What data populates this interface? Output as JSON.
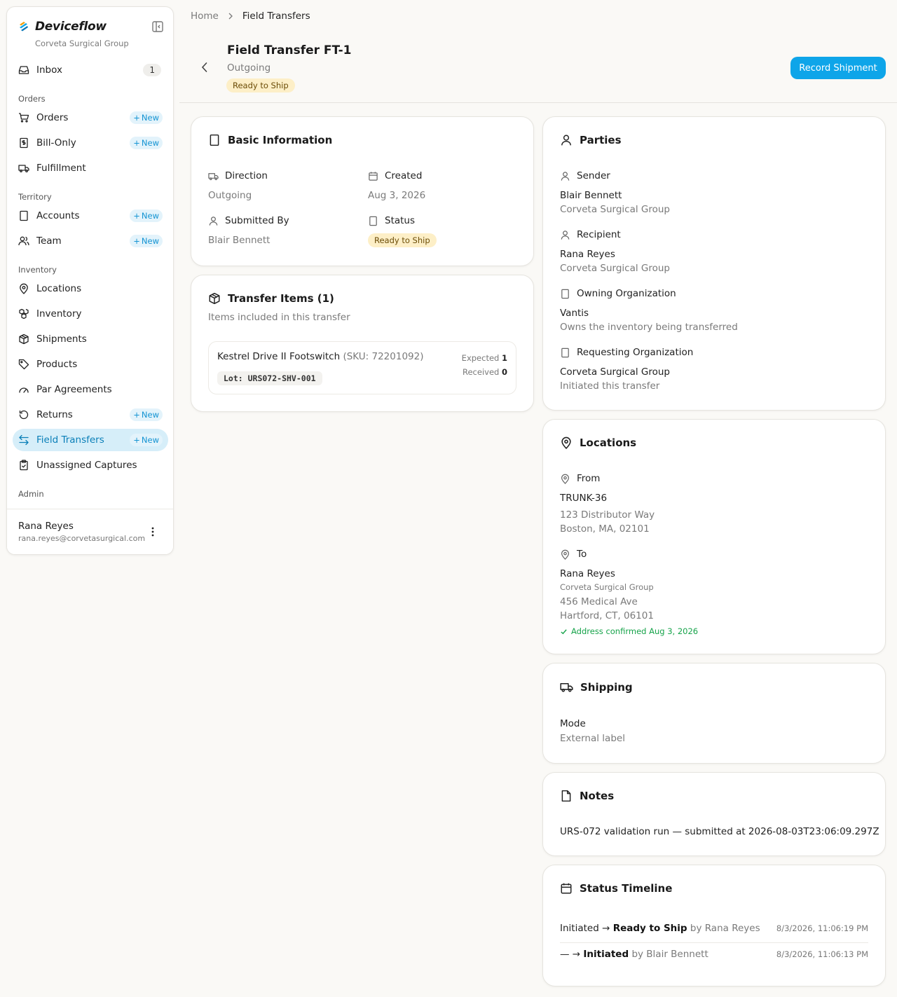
{
  "app": {
    "brand": "Deviceflow",
    "org": "Corveta Surgical Group"
  },
  "sidebar": {
    "inbox": {
      "label": "Inbox",
      "count": "1"
    },
    "sections": {
      "orders": "Orders",
      "territory": "Territory",
      "inventory": "Inventory",
      "admin": "Admin"
    },
    "new_label": "New",
    "items": {
      "orders": "Orders",
      "bill_only": "Bill-Only",
      "fulfillment": "Fulfillment",
      "accounts": "Accounts",
      "team": "Team",
      "locations": "Locations",
      "inventory": "Inventory",
      "shipments": "Shipments",
      "products": "Products",
      "par_agreements": "Par Agreements",
      "returns": "Returns",
      "field_transfers": "Field Transfers",
      "unassigned_captures": "Unassigned Captures"
    },
    "user": {
      "name": "Rana Reyes",
      "email": "rana.reyes@corvetasurgical.com"
    }
  },
  "breadcrumb": {
    "home": "Home",
    "current": "Field Transfers"
  },
  "header": {
    "title": "Field Transfer FT-1",
    "subtitle": "Outgoing",
    "status": "Ready to Ship",
    "primary_action": "Record Shipment"
  },
  "basic_info": {
    "title": "Basic Information",
    "direction_label": "Direction",
    "direction_value": "Outgoing",
    "created_label": "Created",
    "created_value": "Aug 3, 2026",
    "submitted_by_label": "Submitted By",
    "submitted_by_value": "Blair Bennett",
    "status_label": "Status",
    "status_value": "Ready to Ship"
  },
  "transfer_items": {
    "title": "Transfer Items (1)",
    "subtitle": "Items included in this transfer",
    "items": [
      {
        "name": "Kestrel Drive II Footswitch",
        "sku": "(SKU: 72201092)",
        "lot": "Lot: URS072-SHV-001",
        "expected_label": "Expected",
        "expected": "1",
        "received_label": "Received",
        "received": "0"
      }
    ]
  },
  "parties": {
    "title": "Parties",
    "sender_label": "Sender",
    "sender_name": "Blair Bennett",
    "sender_org": "Corveta Surgical Group",
    "recipient_label": "Recipient",
    "recipient_name": "Rana Reyes",
    "recipient_org": "Corveta Surgical Group",
    "owning_label": "Owning Organization",
    "owning_name": "Vantis",
    "owning_note": "Owns the inventory being transferred",
    "requesting_label": "Requesting Organization",
    "requesting_name": "Corveta Surgical Group",
    "requesting_note": "Initiated this transfer"
  },
  "locations": {
    "title": "Locations",
    "from_label": "From",
    "from_name": "TRUNK-36",
    "from_line1": "123 Distributor Way",
    "from_line2": "Boston, MA, 02101",
    "to_label": "To",
    "to_name": "Rana Reyes",
    "to_org": "Corveta Surgical Group",
    "to_line1": "456 Medical Ave",
    "to_line2": "Hartford, CT, 06101",
    "confirmed": "Address confirmed Aug 3, 2026"
  },
  "shipping": {
    "title": "Shipping",
    "mode_label": "Mode",
    "mode_value": "External label"
  },
  "notes": {
    "title": "Notes",
    "text": "URS-072 validation run — submitted at 2026-08-03T23:06:09.297Z"
  },
  "timeline": {
    "title": "Status Timeline",
    "entries": [
      {
        "from": "Initiated",
        "arrow": "→",
        "to": "Ready to Ship",
        "by": "by Rana Reyes",
        "time": "8/3/2026, 11:06:19 PM"
      },
      {
        "from": "—",
        "arrow": "→",
        "to": "Initiated",
        "by": "by Blair Bennett",
        "time": "8/3/2026, 11:06:13 PM"
      }
    ]
  },
  "colors": {
    "accent": "#0ea5e9",
    "active_nav_bg": "#d6eef9",
    "status_pill_bg": "#fdefc7",
    "success": "#16a34a"
  }
}
